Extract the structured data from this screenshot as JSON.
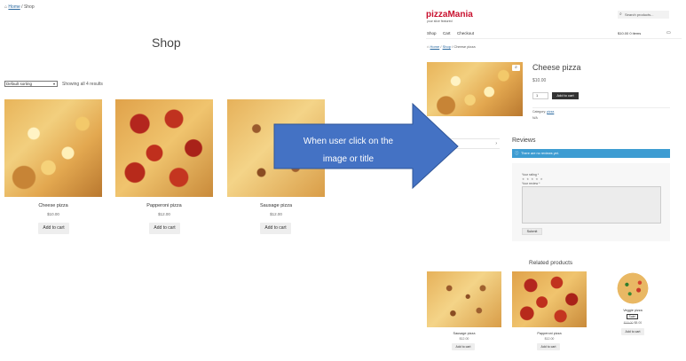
{
  "shop": {
    "breadcrumb": {
      "home": "Home",
      "separator": "/",
      "current": "Shop"
    },
    "title": "Shop",
    "sorting": {
      "selected": "Default sorting"
    },
    "result_count": "Showing all 4 results",
    "products": [
      {
        "name": "Cheese pizza",
        "price": "$10.00",
        "button": "Add to cart"
      },
      {
        "name": "Papperoni pizza",
        "price": "$12.00",
        "button": "Add to cart"
      },
      {
        "name": "Sausage pizza",
        "price": "$12.00",
        "button": "Add to cart"
      }
    ]
  },
  "callout": {
    "line1": "When user click on the",
    "line2": "image or title",
    "color": "#4472c4"
  },
  "product_page": {
    "site_title": "pizzaMania",
    "tagline": "your slice featured",
    "search_placeholder": "Search products...",
    "nav": [
      "Shop",
      "Cart",
      "Checkout"
    ],
    "cart_total": "$10.00  0 items",
    "breadcrumb": {
      "home": "Home",
      "separator": "/",
      "category": "Shop",
      "current": "Cheese pizza"
    },
    "title": "Cheese pizza",
    "price": "$10.00",
    "quantity": "1",
    "add_to_cart": "Add to cart",
    "category_label": "Category:",
    "category_value": "pizza",
    "sku": "N/A",
    "reviews_title": "Reviews",
    "notice": "There are no reviews yet.",
    "rating_label": "Your rating *",
    "rating_stars": "★ ★ ★ ★ ★",
    "review_label": "Your review *",
    "submit": "Submit",
    "related_title": "Related products",
    "related": [
      {
        "name": "Sausage pizza",
        "price": "$12.00",
        "button": "Add to cart"
      },
      {
        "name": "Papperoni pizza",
        "price": "$12.00",
        "button": "Add to cart"
      },
      {
        "name": "Veggie pizza",
        "badge": "Sale!",
        "old_price": "$15.00",
        "price": "$8.00",
        "button": "Add to cart"
      }
    ],
    "brand_color": "#c8102e",
    "notice_color": "#3d9cd2"
  }
}
